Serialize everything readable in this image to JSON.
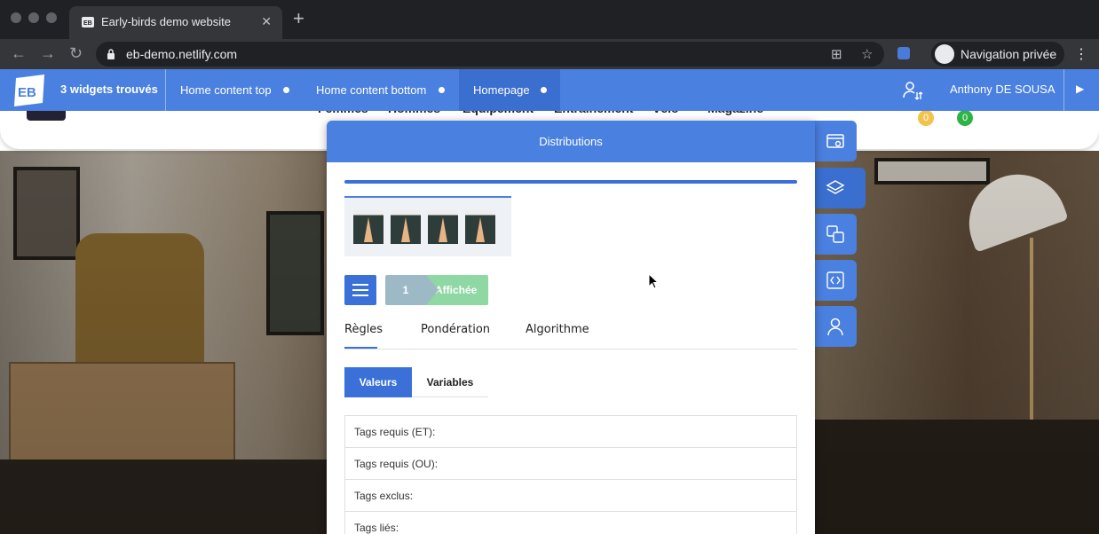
{
  "browser": {
    "tab_title": "Early-birds demo website",
    "new_tab_icon": "plus-icon",
    "url": "eb-demo.netlify.com",
    "incognito_label": "Navigation privée"
  },
  "site": {
    "nav": [
      "Femmes",
      "Hommes",
      "Equipement",
      "Entraînement",
      "Vélo",
      "Magazine"
    ],
    "cart_badge": "0",
    "wishlist_badge": "0"
  },
  "eb_bar": {
    "widgets_found": "3 widgets trouvés",
    "tabs": [
      {
        "label": "Home content top"
      },
      {
        "label": "Home content bottom"
      },
      {
        "label": "Homepage"
      }
    ],
    "active_tab": "Homepage",
    "user_name": "Anthony DE SOUSA"
  },
  "panel": {
    "title": "Distributions",
    "status_number": "1",
    "status_label": "Affichée",
    "tabs": [
      {
        "label": "Règles"
      },
      {
        "label": "Pondération"
      },
      {
        "label": "Algorithme"
      }
    ],
    "active_tab": "Règles",
    "segment": {
      "valeurs": "Valeurs",
      "variables": "Variables",
      "active": "Valeurs"
    },
    "rules": [
      {
        "label": "Tags requis (ET):"
      },
      {
        "label": "Tags requis (OU):"
      },
      {
        "label": "Tags exclus:"
      },
      {
        "label": "Tags liés:"
      }
    ]
  },
  "side_rail": [
    "config-icon",
    "layers-icon",
    "translate-icon",
    "code-icon",
    "user-icon"
  ],
  "colors": {
    "eb_blue": "#4a80e0",
    "eb_blue_dark": "#3a70d8",
    "status_grey": "#9eb9c6",
    "status_green": "#8fd7a3"
  }
}
